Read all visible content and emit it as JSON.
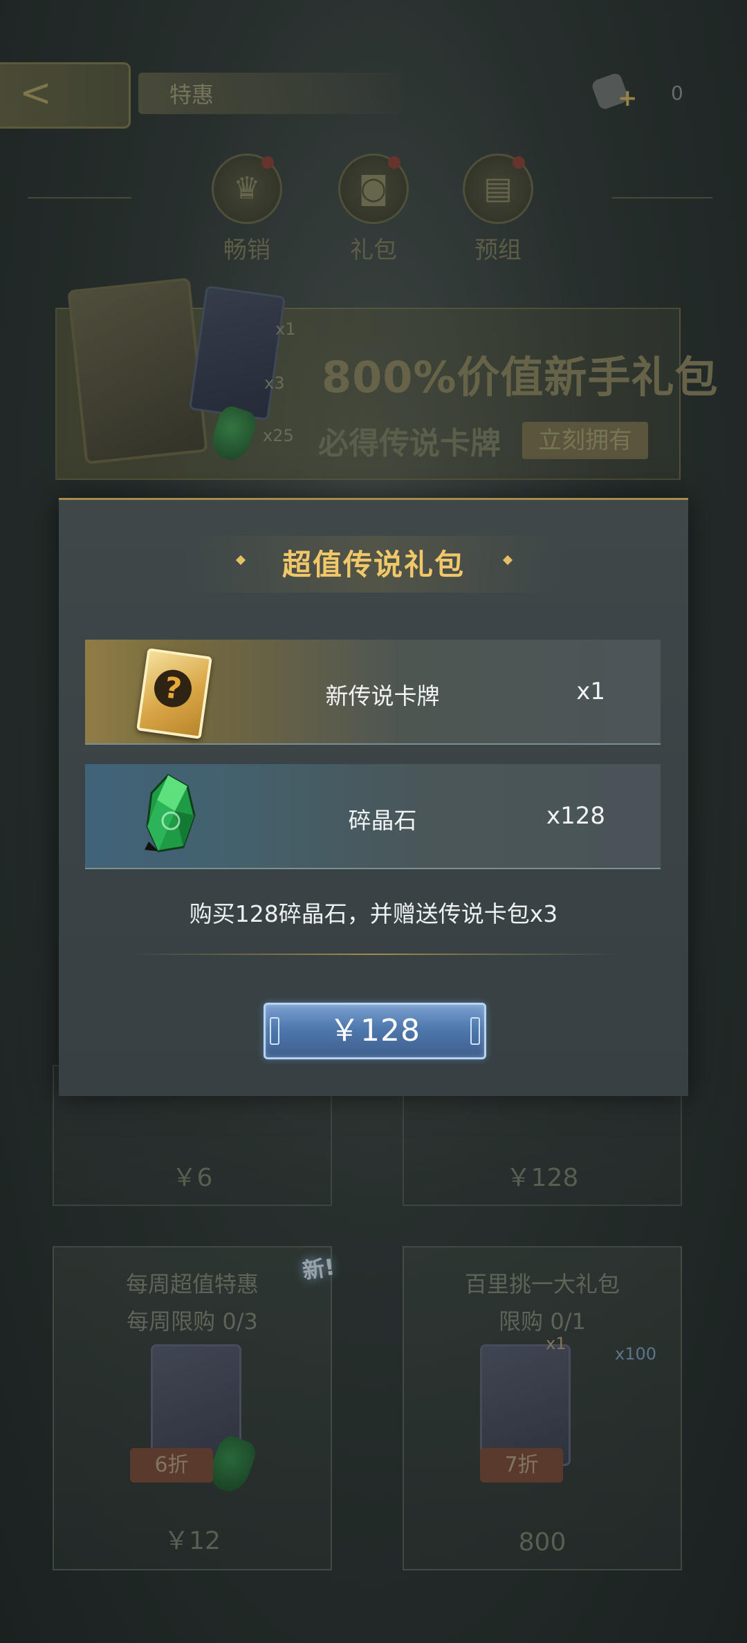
{
  "header": {
    "title": "特惠",
    "currency_value": "0"
  },
  "nav_tabs": [
    {
      "label": "畅销",
      "icon": "trophy-icon"
    },
    {
      "label": "礼包",
      "icon": "gift-bag-icon"
    },
    {
      "label": "预组",
      "icon": "deck-icon"
    }
  ],
  "banner": {
    "title": "800%价值新手礼包",
    "subtitle": "必得传说卡牌",
    "button": "立刻拥有",
    "qty_card": "x1",
    "qty_pack": "x3",
    "qty_gem": "x25"
  },
  "shop_cards": [
    {
      "price": "￥6"
    },
    {
      "price": "￥128"
    },
    {
      "title": "每周超值特惠",
      "limit": "每周限购 0/3",
      "discount": "6折",
      "price": "￥12",
      "badge": "新!"
    },
    {
      "title": "百里挑一大礼包",
      "limit": "限购 0/1",
      "discount": "7折",
      "price": "800",
      "qty_card": "x1",
      "qty_gem": "x100"
    }
  ],
  "modal": {
    "title": "超值传说礼包",
    "items": [
      {
        "name": "新传说卡牌",
        "qty": "x1",
        "icon": "legend-card-icon"
      },
      {
        "name": "碎晶石",
        "qty": "x128",
        "icon": "crystal-gem-icon"
      }
    ],
    "description": "购买128碎晶石，并赠送传说卡包x3",
    "price_button": "￥128"
  },
  "colors": {
    "accent_gold": "#f1c869",
    "button_blue": "#4f78ad"
  }
}
